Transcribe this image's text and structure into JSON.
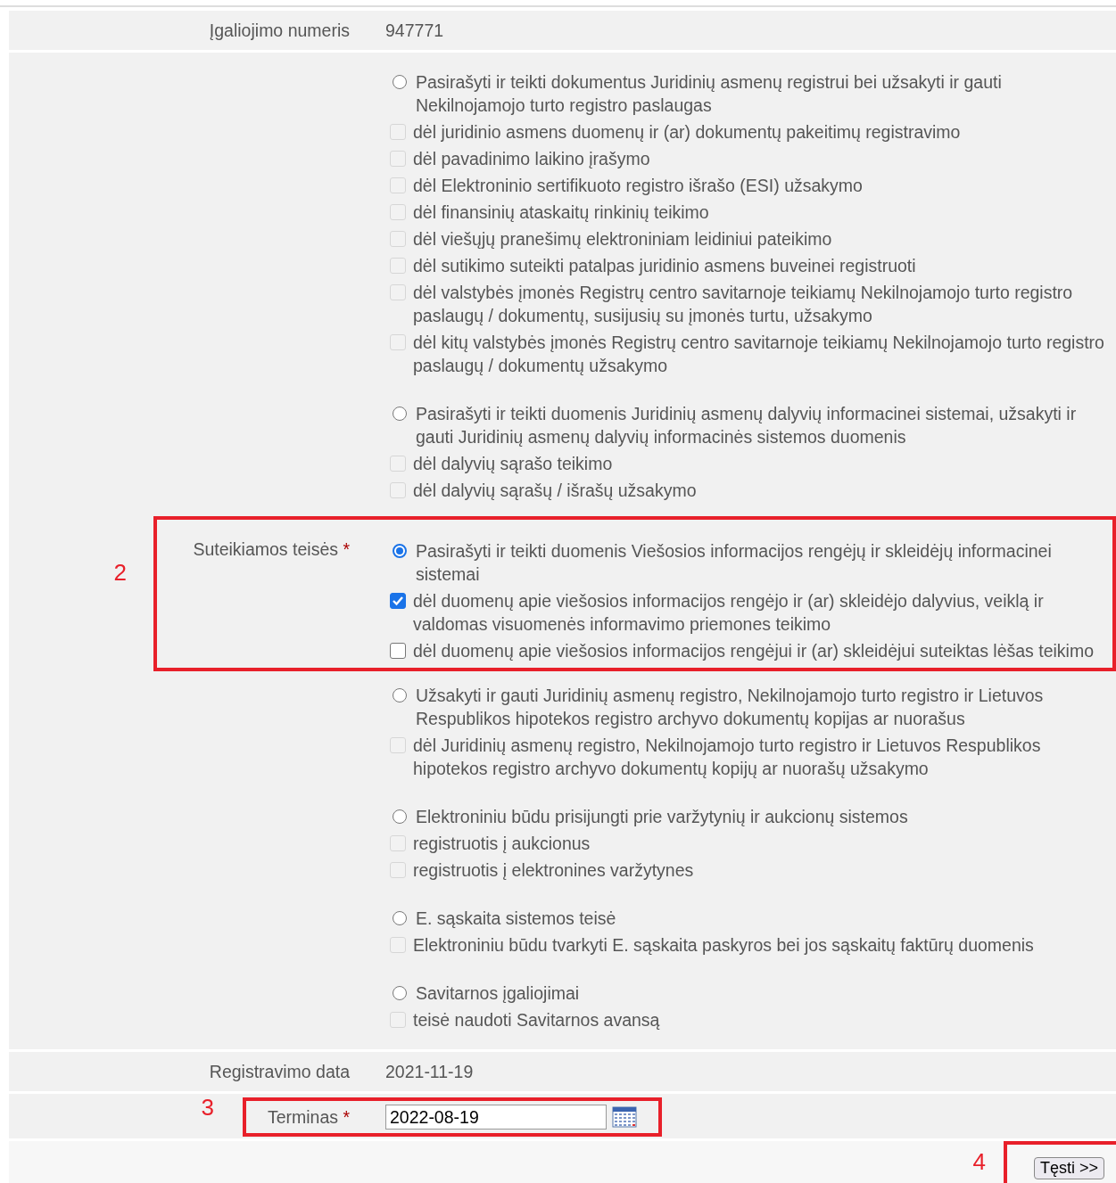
{
  "authorization_number": {
    "label": "Įgaliojimo numeris",
    "value": "947771"
  },
  "rights": {
    "label": "Suteikiamos teisės",
    "required_mark": "*",
    "groups": [
      {
        "title": "Pasirašyti ir teikti dokumentus Juridinių asmenų registrui bei užsakyti ir gauti Nekilnojamojo turto registro paslaugas",
        "selected": false,
        "options": [
          {
            "text": "dėl juridinio asmens duomenų ir (ar) dokumentų pakeitimų registravimo",
            "checked": false,
            "disabled": true
          },
          {
            "text": "dėl pavadinimo laikino įrašymo",
            "checked": false,
            "disabled": true
          },
          {
            "text": "dėl Elektroninio sertifikuoto registro išrašo (ESI) užsakymo",
            "checked": false,
            "disabled": true
          },
          {
            "text": "dėl finansinių ataskaitų rinkinių teikimo",
            "checked": false,
            "disabled": true
          },
          {
            "text": "dėl viešųjų pranešimų elektroniniam leidiniui pateikimo",
            "checked": false,
            "disabled": true
          },
          {
            "text": "dėl sutikimo suteikti patalpas juridinio asmens buveinei registruoti",
            "checked": false,
            "disabled": true
          },
          {
            "text": "dėl valstybės įmonės Registrų centro savitarnoje teikiamų Nekilnojamojo turto registro paslaugų / dokumentų, susijusių su įmonės turtu, užsakymo",
            "checked": false,
            "disabled": true
          },
          {
            "text": "dėl kitų valstybės įmonės Registrų centro savitarnoje teikiamų Nekilnojamojo turto registro paslaugų / dokumentų užsakymo",
            "checked": false,
            "disabled": true
          }
        ]
      },
      {
        "title": "Pasirašyti ir teikti duomenis Juridinių asmenų dalyvių informacinei sistemai, užsakyti ir gauti Juridinių asmenų dalyvių informacinės sistemos duomenis",
        "selected": false,
        "options": [
          {
            "text": "dėl dalyvių sąrašo teikimo",
            "checked": false,
            "disabled": true
          },
          {
            "text": "dėl dalyvių sąrašų / išrašų užsakymo",
            "checked": false,
            "disabled": true
          }
        ]
      },
      {
        "title": "Pasirašyti ir teikti duomenis Viešosios informacijos rengėjų ir skleidėjų informacinei sistemai",
        "selected": true,
        "annotation": "2",
        "options": [
          {
            "text": "dėl duomenų apie viešosios informacijos rengėjo ir (ar) skleidėjo dalyvius, veiklą ir valdomas visuomenės informavimo priemones teikimo",
            "checked": true,
            "disabled": false
          },
          {
            "text": "dėl duomenų apie viešosios informacijos rengėjui ir (ar) skleidėjui suteiktas lėšas teikimo",
            "checked": false,
            "disabled": false
          }
        ]
      },
      {
        "title": "Užsakyti ir gauti Juridinių asmenų registro, Nekilnojamojo turto registro ir Lietuvos Respublikos hipotekos registro archyvo dokumentų kopijas ar nuorašus",
        "selected": false,
        "options": [
          {
            "text": "dėl Juridinių asmenų registro, Nekilnojamojo turto registro ir Lietuvos Respublikos hipotekos registro archyvo dokumentų kopijų ar nuorašų užsakymo",
            "checked": false,
            "disabled": true
          }
        ]
      },
      {
        "title": "Elektroniniu būdu prisijungti prie varžytynių ir aukcionų sistemos",
        "selected": false,
        "options": [
          {
            "text": "registruotis į aukcionus",
            "checked": false,
            "disabled": true
          },
          {
            "text": "registruotis į elektronines varžytynes",
            "checked": false,
            "disabled": true
          }
        ]
      },
      {
        "title": "E. sąskaita sistemos teisė",
        "selected": false,
        "options": [
          {
            "text": "Elektroniniu būdu tvarkyti E. sąskaita paskyros bei jos sąskaitų faktūrų duomenis",
            "checked": false,
            "disabled": true
          }
        ]
      },
      {
        "title": "Savitarnos įgaliojimai",
        "selected": false,
        "options": [
          {
            "text": "teisė naudoti Savitarnos avansą",
            "checked": false,
            "disabled": true
          }
        ]
      }
    ]
  },
  "registration_date": {
    "label": "Registravimo data",
    "value": "2021-11-19"
  },
  "term": {
    "label": "Terminas",
    "required_mark": "*",
    "value": "2022-08-19",
    "annotation": "3"
  },
  "continue_button": {
    "label": "Tęsti >>",
    "annotation": "4"
  }
}
